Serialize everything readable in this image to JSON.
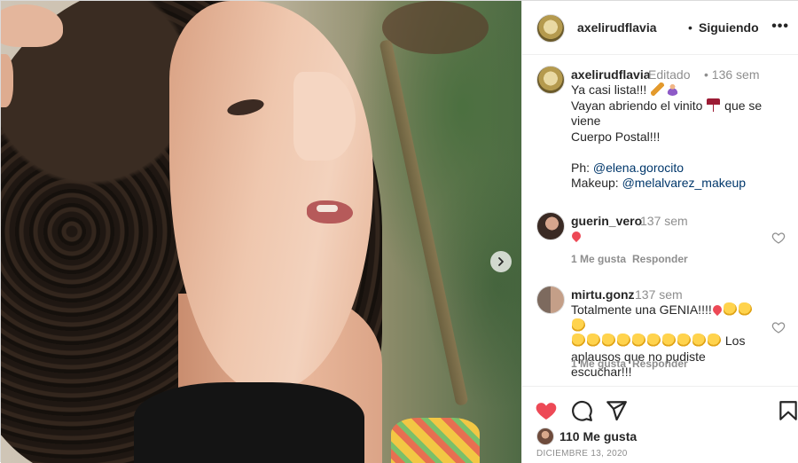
{
  "post": {
    "username": "axelirudflavia",
    "dot": "•",
    "follow_label": "Siguiendo",
    "more_label": "•••",
    "photo_alt": "Foto de perfil de una mujer de cabello rizado"
  },
  "caption": {
    "username": "axelirudflavia",
    "edited": "Editado",
    "time": "• 136 sem",
    "line1": "Ya casi lista!!! ",
    "line2a": "Vayan abriendo el vinito ",
    "line2b": " que se viene",
    "line3": "Cuerpo Postal!!!",
    "ph_label": "Ph: ",
    "ph_mention": "@elena.gorocito",
    "makeup_label": "Makeup: ",
    "makeup_mention": "@melalvarez_makeup"
  },
  "comments": [
    {
      "username": "guerin_vero",
      "time": "137 sem",
      "likes": "1 Me gusta",
      "reply": "Responder"
    },
    {
      "username": "mirtu.gonz",
      "time": "137 sem",
      "text1": "Totalmente una GENIA!!!!",
      "text2": " Los",
      "text3": "aplausos que no pudiste escuchar!!!",
      "likes": "1 Me gusta",
      "reply": "Responder"
    }
  ],
  "footer": {
    "likes": "110 Me gusta",
    "date": "DICIEMBRE 13, 2020"
  },
  "icons": {
    "like": "heart-filled-icon",
    "comment": "comment-icon",
    "share": "send-icon",
    "save": "bookmark-icon",
    "next": "chevron-right-icon"
  },
  "colors": {
    "like_red": "#ed4956",
    "mention_blue": "#00376b",
    "muted": "#8e8e8e"
  }
}
